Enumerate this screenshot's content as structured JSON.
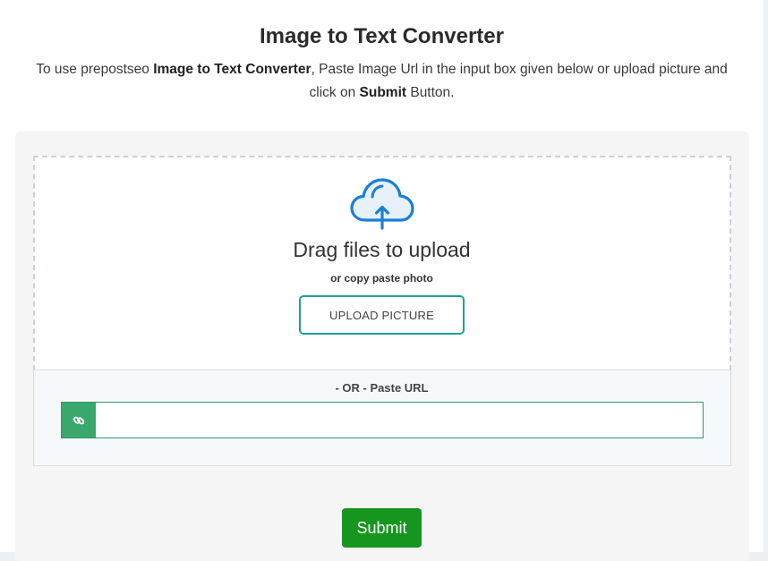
{
  "header": {
    "title": "Image to Text Converter",
    "intro": {
      "part1": "To use prepostseo ",
      "bold1": "Image to Text Converter",
      "part2": ", Paste Image Url in the input box given below or upload picture and click on ",
      "bold2": "Submit",
      "part3": " Button."
    }
  },
  "upload": {
    "icon": "cloud-upload-icon",
    "drag_text": "Drag files to upload",
    "copy_text": "or copy paste photo",
    "button_label": "UPLOAD PICTURE"
  },
  "url": {
    "label": "- OR - Paste URL",
    "icon": "link-icon",
    "value": "",
    "placeholder": ""
  },
  "actions": {
    "submit_label": "Submit"
  },
  "colors": {
    "accent_teal": "#1aa394",
    "link_addon_green": "#3aa76d",
    "submit_green": "#17961f",
    "cloud_blue": "#1a7fd6"
  }
}
